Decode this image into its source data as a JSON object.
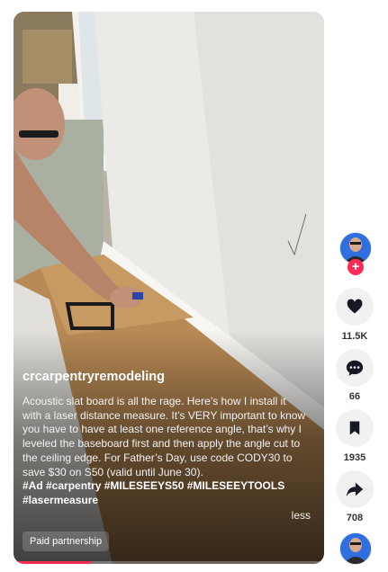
{
  "video": {
    "username": "crcarpentryremodeling",
    "caption": "Acoustic slat board is all the rage. Here’s how I install it with a laser distance measure. It’s VERY important to know you have to have at least one reference angle, that’s why I leveled the baseboard first and then apply the angle cut to the ceiling edge. For Father’s Day, use code CODY30 to save $30 on S50 (valid until June 30).",
    "hashtags": "#Ad #carpentry #MILESEEYS50 #MILESEEYTOOLS #lasermeasure",
    "less_label": "less",
    "paid_label": "Paid partnership",
    "progress": 0.25
  },
  "actions": {
    "follow_symbol": "+",
    "like_count": "11.5K",
    "comment_count": "66",
    "save_count": "1935",
    "share_count": "708"
  },
  "icons": [
    "heart-icon",
    "comment-icon",
    "bookmark-icon",
    "share-icon",
    "plus-icon"
  ],
  "colors": {
    "accent": "#fe2c55",
    "rail_button": "#f1f1f2",
    "avatar_bg": "#2f6fe0"
  }
}
